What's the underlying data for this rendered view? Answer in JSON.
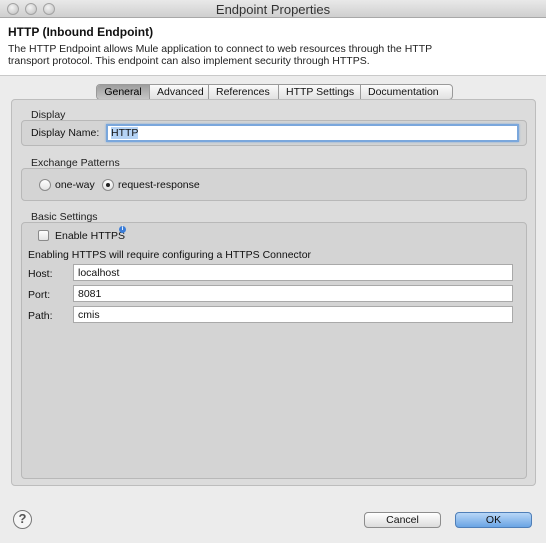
{
  "window": {
    "title": "Endpoint Properties"
  },
  "header": {
    "title": "HTTP (Inbound Endpoint)",
    "description": "The HTTP Endpoint allows Mule application to connect to web resources through the HTTP transport protocol. This endpoint can also implement security through HTTPS."
  },
  "tabs": [
    {
      "label": "General",
      "active": true
    },
    {
      "label": "Advanced",
      "active": false
    },
    {
      "label": "References",
      "active": false
    },
    {
      "label": "HTTP Settings",
      "active": false
    },
    {
      "label": "Documentation",
      "active": false
    }
  ],
  "display": {
    "section_label": "Display",
    "name_label": "Display Name:",
    "name_value": "HTTP"
  },
  "exchange": {
    "section_label": "Exchange Patterns",
    "options": [
      {
        "label": "one-way",
        "checked": false
      },
      {
        "label": "request-response",
        "checked": true
      }
    ]
  },
  "basic": {
    "section_label": "Basic Settings",
    "enable_https_label": "Enable HTTPS",
    "enable_https_checked": false,
    "https_note": "Enabling HTTPS will require configuring a HTTPS Connector",
    "host_label": "Host:",
    "host_value": "localhost",
    "port_label": "Port:",
    "port_value": "8081",
    "path_label": "Path:",
    "path_value": "cmis"
  },
  "footer": {
    "help_glyph": "?",
    "cancel_label": "Cancel",
    "ok_label": "OK"
  },
  "colors": {
    "ok_button": "#6aa4e4",
    "focus_ring": "#7aa7dc",
    "info_icon": "#3b7dd8"
  }
}
